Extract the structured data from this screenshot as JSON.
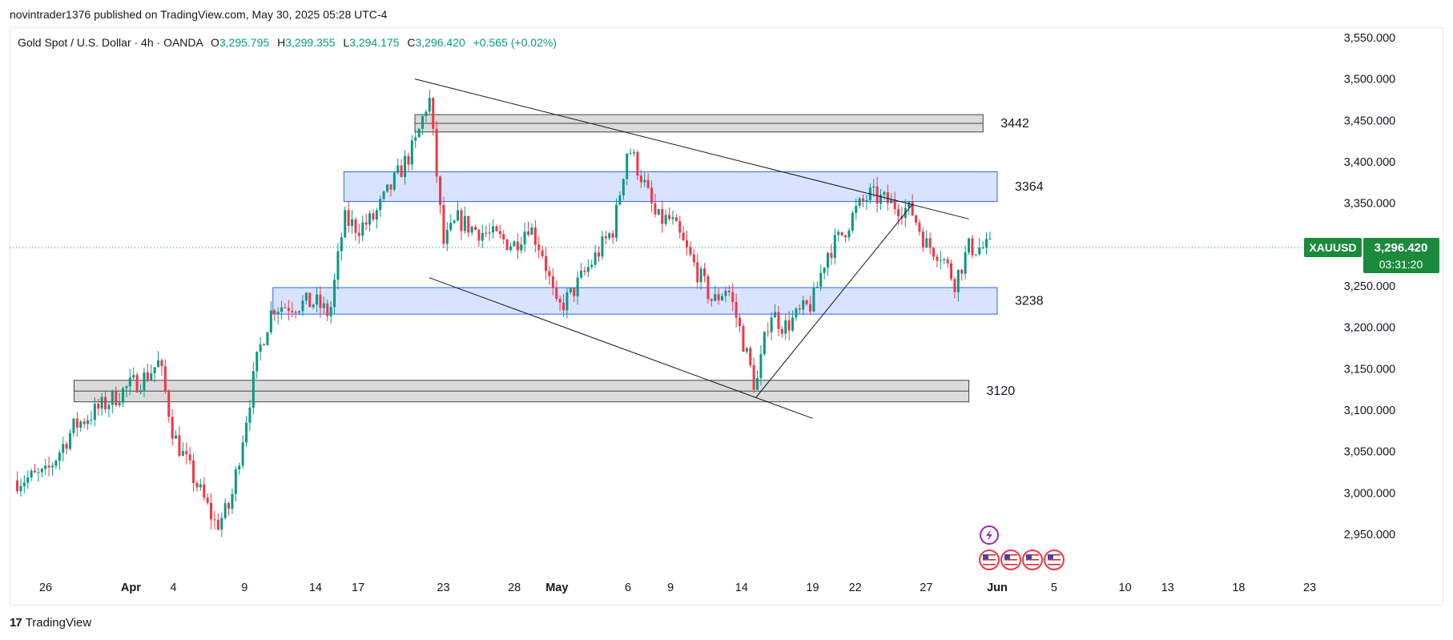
{
  "publisher_line": "novintrader1376 published on TradingView.com, May 30, 2025 05:28 UTC-4",
  "legend": {
    "symbol": "Gold Spot / U.S. Dollar · 4h · OANDA",
    "open_key": "O",
    "open": "3,295.795",
    "high_key": "H",
    "high": "3,299.355",
    "low_key": "L",
    "low": "3,294.175",
    "close_key": "C",
    "close": "3,296.420",
    "change": "+0.565 (+0.02%)"
  },
  "price_tag": {
    "ticker": "XAUUSD",
    "price": "3,296.420",
    "countdown": "03:31:20"
  },
  "logo_text": "TradingView",
  "colors": {
    "up": "#089981",
    "down": "#f23645",
    "blue_zone": "#d6e2ff",
    "blue_border": "#2962ff",
    "grey_zone": "#d9d9d9",
    "tag": "#1b8a3c"
  },
  "event_icons": [
    "lightning-icon",
    "us-flag-icon",
    "us-flag-icon",
    "us-flag-icon",
    "us-flag-icon"
  ],
  "chart_data": {
    "type": "candlestick",
    "title": "Gold Spot / U.S. Dollar · 4h · OANDA",
    "ylim": [
      2900,
      3570
    ],
    "y_ticks": [
      "3,550.000",
      "3,500.000",
      "3,450.000",
      "3,400.000",
      "3,350.000",
      "3,250.000",
      "3,200.000",
      "3,150.000",
      "3,100.000",
      "3,050.000",
      "3,000.000",
      "2,950.000"
    ],
    "y_tick_values": [
      3550,
      3500,
      3450,
      3400,
      3350,
      3250,
      3200,
      3150,
      3100,
      3050,
      3000,
      2950
    ],
    "x_ticks": [
      "26",
      "Apr",
      "4",
      "9",
      "14",
      "17",
      "23",
      "28",
      "May",
      "6",
      "9",
      "14",
      "19",
      "22",
      "27",
      "Jun",
      "5",
      "10",
      "13",
      "18",
      "23"
    ],
    "x_tick_dates": [
      "2025-03-26",
      "2025-04-01",
      "2025-04-04",
      "2025-04-09",
      "2025-04-14",
      "2025-04-17",
      "2025-04-23",
      "2025-04-28",
      "2025-05-01",
      "2025-05-06",
      "2025-05-09",
      "2025-05-14",
      "2025-05-19",
      "2025-05-22",
      "2025-05-27",
      "2025-06-01",
      "2025-06-05",
      "2025-06-10",
      "2025-06-13",
      "2025-06-18",
      "2025-06-23"
    ],
    "bold_ticks": [
      "Apr",
      "May",
      "Jun"
    ],
    "current_price": 3296.42,
    "zones": [
      {
        "label": "3442",
        "low": 3436,
        "high": 3457,
        "style": "grey",
        "from": "2025-04-21",
        "to": "2025-05-31"
      },
      {
        "label": "3364",
        "low": 3352,
        "high": 3388,
        "style": "blue",
        "from": "2025-04-16",
        "to": "2025-06-01"
      },
      {
        "label": "3238",
        "low": 3216,
        "high": 3248,
        "style": "blue",
        "from": "2025-04-11",
        "to": "2025-06-01"
      },
      {
        "label": "3120",
        "low": 3110,
        "high": 3136,
        "style": "grey",
        "from": "2025-03-28",
        "to": "2025-05-30"
      }
    ],
    "trendlines": [
      {
        "from": [
          "2025-04-21",
          3500
        ],
        "to": [
          "2025-05-30",
          3331
        ]
      },
      {
        "from": [
          "2025-04-22",
          3260
        ],
        "to": [
          "2025-05-19",
          3090
        ]
      },
      {
        "from": [
          "2025-05-15",
          3115
        ],
        "to": [
          "2025-05-26",
          3348
        ]
      }
    ],
    "price_path": [
      [
        "2025-03-24",
        3015
      ],
      [
        "2025-03-26",
        3022
      ],
      [
        "2025-03-28",
        3080
      ],
      [
        "2025-04-01",
        3130
      ],
      [
        "2025-04-02",
        3140
      ],
      [
        "2025-04-03",
        3158
      ],
      [
        "2025-04-04",
        3070
      ],
      [
        "2025-04-07",
        2960
      ],
      [
        "2025-04-08",
        2985
      ],
      [
        "2025-04-09",
        3080
      ],
      [
        "2025-04-10",
        3170
      ],
      [
        "2025-04-11",
        3225
      ],
      [
        "2025-04-14",
        3230
      ],
      [
        "2025-04-15",
        3215
      ],
      [
        "2025-04-16",
        3330
      ],
      [
        "2025-04-17",
        3320
      ],
      [
        "2025-04-18",
        3330
      ],
      [
        "2025-04-21",
        3420
      ],
      [
        "2025-04-22",
        3480
      ],
      [
        "2025-04-23",
        3300
      ],
      [
        "2025-04-24",
        3330
      ],
      [
        "2025-04-25",
        3320
      ],
      [
        "2025-04-28",
        3300
      ],
      [
        "2025-04-29",
        3325
      ],
      [
        "2025-04-30",
        3290
      ],
      [
        "2025-05-01",
        3220
      ],
      [
        "2025-05-02",
        3240
      ],
      [
        "2025-05-05",
        3320
      ],
      [
        "2025-05-06",
        3420
      ],
      [
        "2025-05-07",
        3380
      ],
      [
        "2025-05-08",
        3330
      ],
      [
        "2025-05-09",
        3330
      ],
      [
        "2025-05-12",
        3230
      ],
      [
        "2025-05-13",
        3250
      ],
      [
        "2025-05-14",
        3190
      ],
      [
        "2025-05-15",
        3125
      ],
      [
        "2025-05-16",
        3220
      ],
      [
        "2025-05-17",
        3200
      ],
      [
        "2025-05-19",
        3230
      ],
      [
        "2025-05-20",
        3290
      ],
      [
        "2025-05-21",
        3310
      ],
      [
        "2025-05-22",
        3340
      ],
      [
        "2025-05-23",
        3360
      ],
      [
        "2025-05-26",
        3340
      ],
      [
        "2025-05-27",
        3300
      ],
      [
        "2025-05-28",
        3290
      ],
      [
        "2025-05-29",
        3255
      ],
      [
        "2025-05-30",
        3296
      ]
    ]
  }
}
